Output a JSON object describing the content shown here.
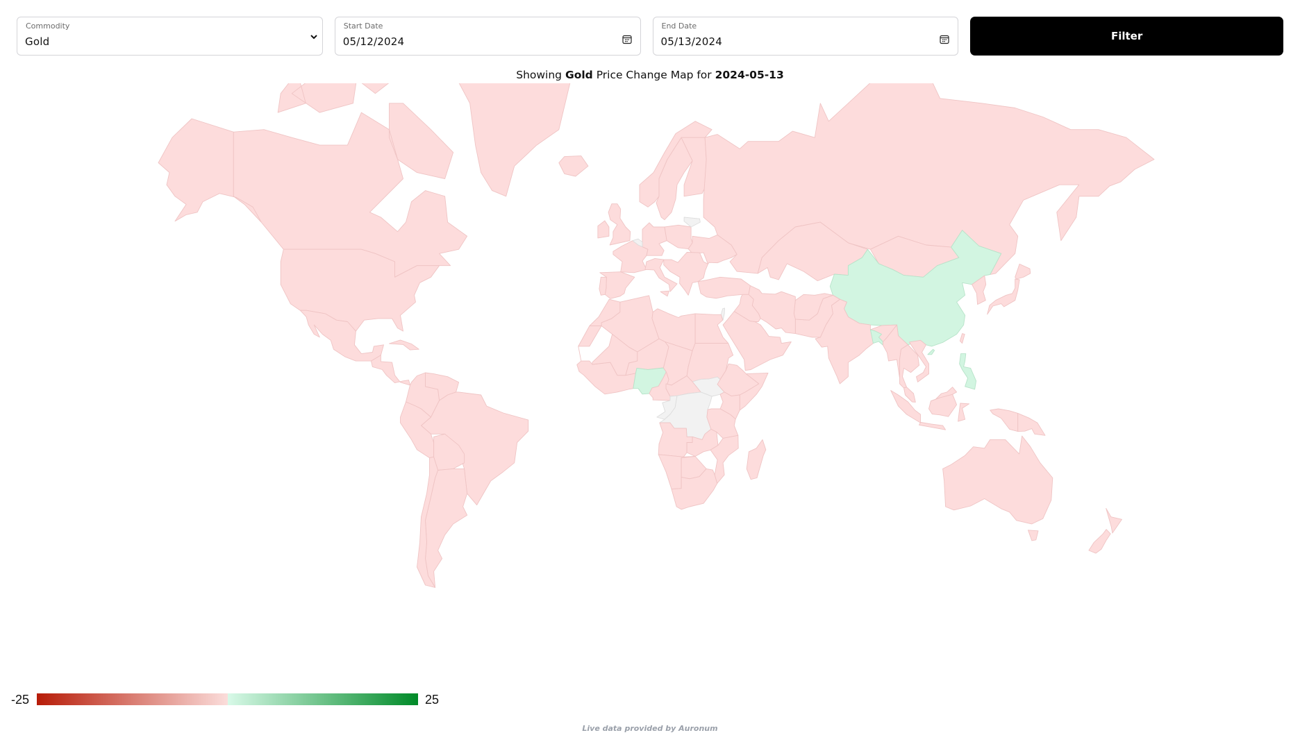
{
  "filters": {
    "commodity": {
      "label": "Commodity",
      "value": "Gold",
      "icon": "chevron-down-icon"
    },
    "start_date": {
      "label": "Start Date",
      "value": "05/12/2024",
      "icon": "calendar-icon"
    },
    "end_date": {
      "label": "End Date",
      "value": "05/13/2024",
      "icon": "calendar-icon"
    },
    "filter_button": "Filter"
  },
  "caption": {
    "prefix": "Showing",
    "commodity": "Gold",
    "middle": "Price Change Map for",
    "date": "2024-05-13"
  },
  "legend": {
    "min_label": "-25",
    "max_label": "25",
    "min": -25,
    "max": 25,
    "colors": {
      "negative_strong": "#b71c08",
      "negative_weak": "#fbdddb",
      "positive_weak": "#d8f9e8",
      "positive_strong": "#008a28",
      "no_data": "#f2f2f2"
    }
  },
  "footer": "Live data provided by Auronum",
  "map_data": {
    "type": "choropleth",
    "metric": "Gold price change",
    "status_colors": {
      "negative": {
        "fill": "#fddcdc",
        "stroke": "#efc4c4"
      },
      "positive": {
        "fill": "#d2f5e1",
        "stroke": "#b7e3c9"
      },
      "no_data": {
        "fill": "#f2f2f2",
        "stroke": "#dddddd"
      }
    },
    "countries": [
      {
        "name": "Canada",
        "status": "negative"
      },
      {
        "name": "United States",
        "status": "negative"
      },
      {
        "name": "Alaska",
        "status": "negative"
      },
      {
        "name": "Greenland",
        "status": "negative"
      },
      {
        "name": "Iceland",
        "status": "negative"
      },
      {
        "name": "Mexico",
        "status": "negative"
      },
      {
        "name": "Central America",
        "status": "negative"
      },
      {
        "name": "Cuba",
        "status": "negative"
      },
      {
        "name": "Colombia",
        "status": "negative"
      },
      {
        "name": "Venezuela",
        "status": "negative"
      },
      {
        "name": "Brazil",
        "status": "negative"
      },
      {
        "name": "Peru",
        "status": "negative"
      },
      {
        "name": "Bolivia",
        "status": "negative"
      },
      {
        "name": "Argentina",
        "status": "negative"
      },
      {
        "name": "Chile",
        "status": "negative"
      },
      {
        "name": "United Kingdom",
        "status": "negative"
      },
      {
        "name": "Ireland",
        "status": "negative"
      },
      {
        "name": "France",
        "status": "negative"
      },
      {
        "name": "Spain",
        "status": "negative"
      },
      {
        "name": "Portugal",
        "status": "negative"
      },
      {
        "name": "Germany",
        "status": "negative"
      },
      {
        "name": "Italy",
        "status": "negative"
      },
      {
        "name": "Poland",
        "status": "negative"
      },
      {
        "name": "Norway",
        "status": "negative"
      },
      {
        "name": "Sweden",
        "status": "negative"
      },
      {
        "name": "Finland",
        "status": "negative"
      },
      {
        "name": "Belgium",
        "status": "no_data"
      },
      {
        "name": "Lithuania",
        "status": "no_data"
      },
      {
        "name": "Kosovo",
        "status": "no_data"
      },
      {
        "name": "Ukraine",
        "status": "negative"
      },
      {
        "name": "Balkans",
        "status": "negative"
      },
      {
        "name": "Turkey",
        "status": "negative"
      },
      {
        "name": "Russia",
        "status": "negative"
      },
      {
        "name": "Kazakhstan",
        "status": "negative"
      },
      {
        "name": "Mongolia",
        "status": "negative"
      },
      {
        "name": "China",
        "status": "positive"
      },
      {
        "name": "India",
        "status": "negative"
      },
      {
        "name": "Bangladesh",
        "status": "positive"
      },
      {
        "name": "Pakistan",
        "status": "negative"
      },
      {
        "name": "Afghanistan",
        "status": "negative"
      },
      {
        "name": "Iran",
        "status": "negative"
      },
      {
        "name": "Iraq",
        "status": "negative"
      },
      {
        "name": "Saudi Arabia",
        "status": "negative"
      },
      {
        "name": "Israel",
        "status": "no_data"
      },
      {
        "name": "Myanmar",
        "status": "negative"
      },
      {
        "name": "Thailand",
        "status": "negative"
      },
      {
        "name": "Vietnam",
        "status": "negative"
      },
      {
        "name": "Korea",
        "status": "negative"
      },
      {
        "name": "Japan",
        "status": "negative"
      },
      {
        "name": "Taiwan",
        "status": "negative"
      },
      {
        "name": "Philippines",
        "status": "positive"
      },
      {
        "name": "Malaysia",
        "status": "negative"
      },
      {
        "name": "Indonesia",
        "status": "negative"
      },
      {
        "name": "Papua New Guinea",
        "status": "negative"
      },
      {
        "name": "Australia",
        "status": "negative"
      },
      {
        "name": "New Zealand",
        "status": "negative"
      },
      {
        "name": "Morocco",
        "status": "negative"
      },
      {
        "name": "Algeria",
        "status": "negative"
      },
      {
        "name": "Libya",
        "status": "negative"
      },
      {
        "name": "Egypt",
        "status": "negative"
      },
      {
        "name": "West Africa",
        "status": "negative"
      },
      {
        "name": "Mali",
        "status": "negative"
      },
      {
        "name": "Niger",
        "status": "negative"
      },
      {
        "name": "Nigeria",
        "status": "positive"
      },
      {
        "name": "Chad",
        "status": "negative"
      },
      {
        "name": "Sudan",
        "status": "negative"
      },
      {
        "name": "South Sudan",
        "status": "no_data"
      },
      {
        "name": "Ethiopia",
        "status": "negative"
      },
      {
        "name": "Somalia",
        "status": "negative"
      },
      {
        "name": "Cameroon",
        "status": "negative"
      },
      {
        "name": "Central African Republic",
        "status": "negative"
      },
      {
        "name": "Republic of the Congo",
        "status": "no_data"
      },
      {
        "name": "DR Congo",
        "status": "no_data"
      },
      {
        "name": "Kenya",
        "status": "negative"
      },
      {
        "name": "Tanzania",
        "status": "negative"
      },
      {
        "name": "Angola",
        "status": "negative"
      },
      {
        "name": "Zambia",
        "status": "negative"
      },
      {
        "name": "Mozambique",
        "status": "negative"
      },
      {
        "name": "Namibia",
        "status": "negative"
      },
      {
        "name": "Botswana",
        "status": "negative"
      },
      {
        "name": "South Africa",
        "status": "negative"
      },
      {
        "name": "Madagascar",
        "status": "negative"
      }
    ]
  }
}
